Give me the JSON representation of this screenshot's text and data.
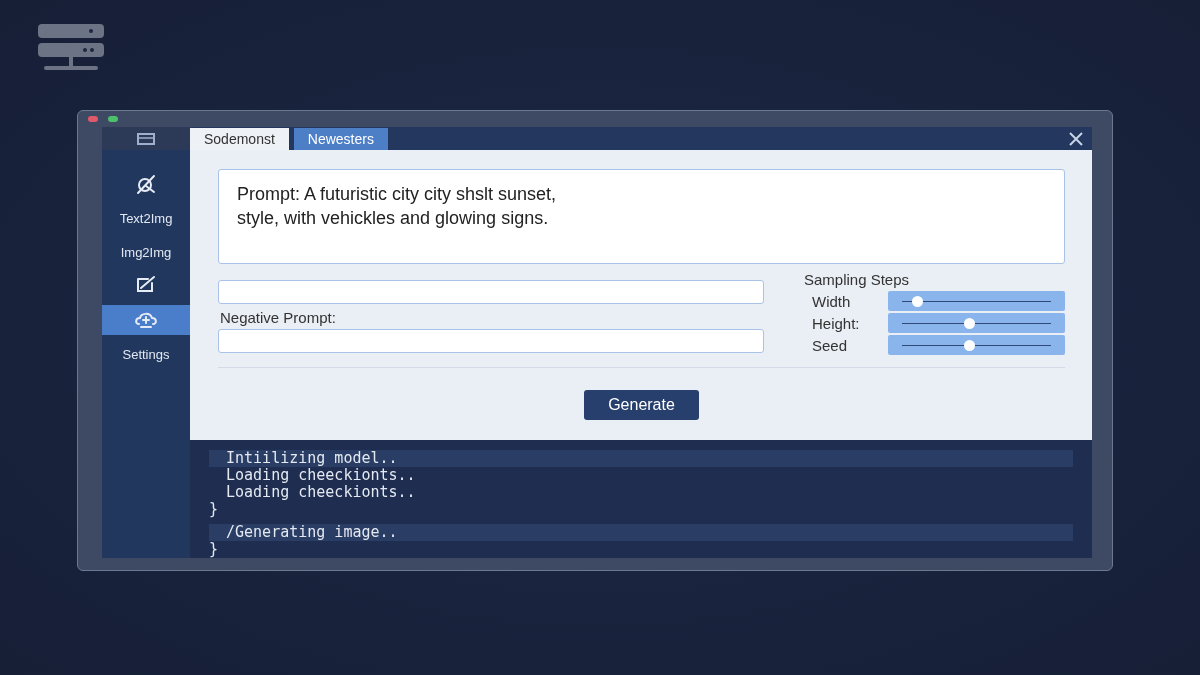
{
  "sidebar": {
    "items": [
      {
        "kind": "icon",
        "selected": false
      },
      {
        "kind": "text",
        "label": "Text2Img",
        "selected": false
      },
      {
        "kind": "text",
        "label": "Img2Img",
        "selected": false
      },
      {
        "kind": "icon",
        "selected": false
      },
      {
        "kind": "icon",
        "selected": true
      },
      {
        "kind": "text",
        "label": "Settings",
        "selected": false
      }
    ]
  },
  "tabs": [
    {
      "label": "Sodemonst",
      "selected": true
    },
    {
      "label": "Newesters",
      "selected": false
    }
  ],
  "prompt": {
    "value": "Prompt: A futuristic city city shslt sunset,\nstyle, with vehickles and glowing signs."
  },
  "negative_prompt": {
    "label": "Negative Prompt:"
  },
  "sampling": {
    "title": "Sampling Steps",
    "sliders": [
      {
        "label": "Width",
        "level": 0.1
      },
      {
        "label": "Height:",
        "level": 0.45
      },
      {
        "label": "Seed",
        "level": 0.45
      }
    ]
  },
  "generate_button": "Generate",
  "console": {
    "lines": [
      {
        "kind": "line",
        "text": "Intiilizing model..",
        "highlighted": true
      },
      {
        "kind": "line",
        "text": "Loading cheeckionts..",
        "highlighted": false
      },
      {
        "kind": "line",
        "text": "Loading cheeckionts..",
        "highlighted": false
      },
      {
        "kind": "brace",
        "text": "}",
        "highlighted": false
      },
      {
        "kind": "line",
        "text": "/Generating image..",
        "highlighted": true
      },
      {
        "kind": "brace",
        "text": "}",
        "highlighted": false
      }
    ]
  }
}
